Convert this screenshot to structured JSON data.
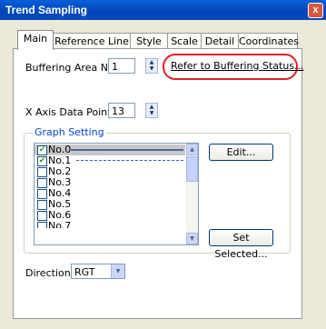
{
  "window": {
    "title": "Trend Sampling",
    "close_glyph": "x"
  },
  "tabs": [
    {
      "label": "Main",
      "active": true
    },
    {
      "label": "Reference Line",
      "active": false
    },
    {
      "label": "Style",
      "active": false
    },
    {
      "label": "Scale",
      "active": false
    },
    {
      "label": "Detail",
      "active": false
    },
    {
      "label": "Coordinates",
      "active": false
    }
  ],
  "main": {
    "buffering_label": "Buffering Area No.",
    "buffering_value": "1",
    "refer_link": "Refer to Buffering Status...",
    "xaxis_label": "X Axis Data Points",
    "xaxis_value": "13",
    "graph_setting_title": "Graph Setting",
    "graph_items": [
      {
        "label": "No.0",
        "checked": true,
        "line": "solid"
      },
      {
        "label": "No.1",
        "checked": true,
        "line": "dashed"
      },
      {
        "label": "No.2",
        "checked": false
      },
      {
        "label": "No.3",
        "checked": false
      },
      {
        "label": "No.4",
        "checked": false
      },
      {
        "label": "No.5",
        "checked": false
      },
      {
        "label": "No.6",
        "checked": false
      },
      {
        "label": "No.7",
        "checked": false
      }
    ],
    "edit_button": "Edit...",
    "set_selected_button": "Set Selected...",
    "direction_label": "Direction",
    "direction_value": "RGT"
  },
  "colors": {
    "highlight": "#e02020",
    "group_title": "#0046d5",
    "titlebar": "#0a5fd8"
  }
}
